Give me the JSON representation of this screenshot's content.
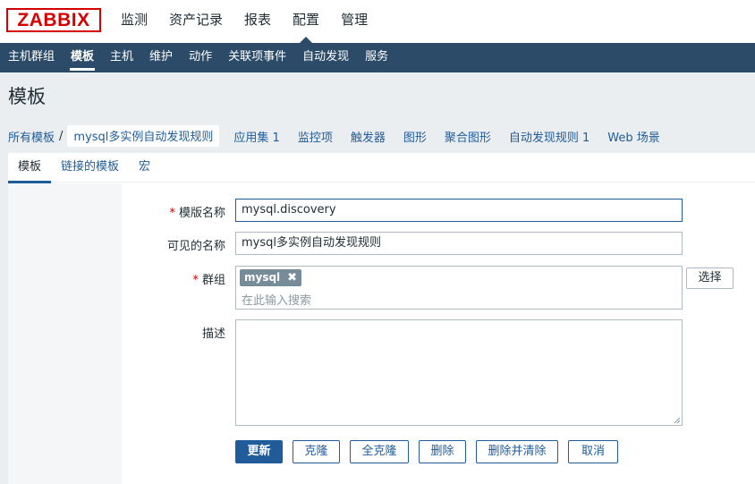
{
  "brand": "ZABBIX",
  "main_menu": [
    "监测",
    "资产记录",
    "报表",
    "配置",
    "管理"
  ],
  "main_menu_active": "配置",
  "sub_menu": [
    "主机群组",
    "模板",
    "主机",
    "维护",
    "动作",
    "关联项事件",
    "自动发现",
    "服务"
  ],
  "sub_menu_active": "模板",
  "page_title": "模板",
  "breadcrumb": {
    "root": "所有模板",
    "separator": "/",
    "current": "mysql多实例自动发现规则",
    "links": [
      "应用集 1",
      "监控项",
      "触发器",
      "图形",
      "聚合图形",
      "自动发现规则 1",
      "Web 场景"
    ]
  },
  "tabs": [
    "模板",
    "链接的模板",
    "宏"
  ],
  "form": {
    "template_name_label": "模版名称",
    "template_name_value": "mysql.discovery",
    "visible_name_label": "可见的名称",
    "visible_name_value": "mysql多实例自动发现规则",
    "groups_label": "群组",
    "group_tag": "mysql",
    "group_search_placeholder": "在此输入搜索",
    "select_button": "选择",
    "description_label": "描述",
    "required_mark": "*"
  },
  "buttons": {
    "update": "更新",
    "clone": "克隆",
    "full_clone": "全克隆",
    "delete": "删除",
    "delete_and_clear": "删除并清除",
    "cancel": "取消"
  },
  "colors": {
    "brand_red": "#d40000",
    "nav_blue": "#2b4b68",
    "link_blue": "#1f5c99",
    "tag_gray": "#768d99"
  }
}
